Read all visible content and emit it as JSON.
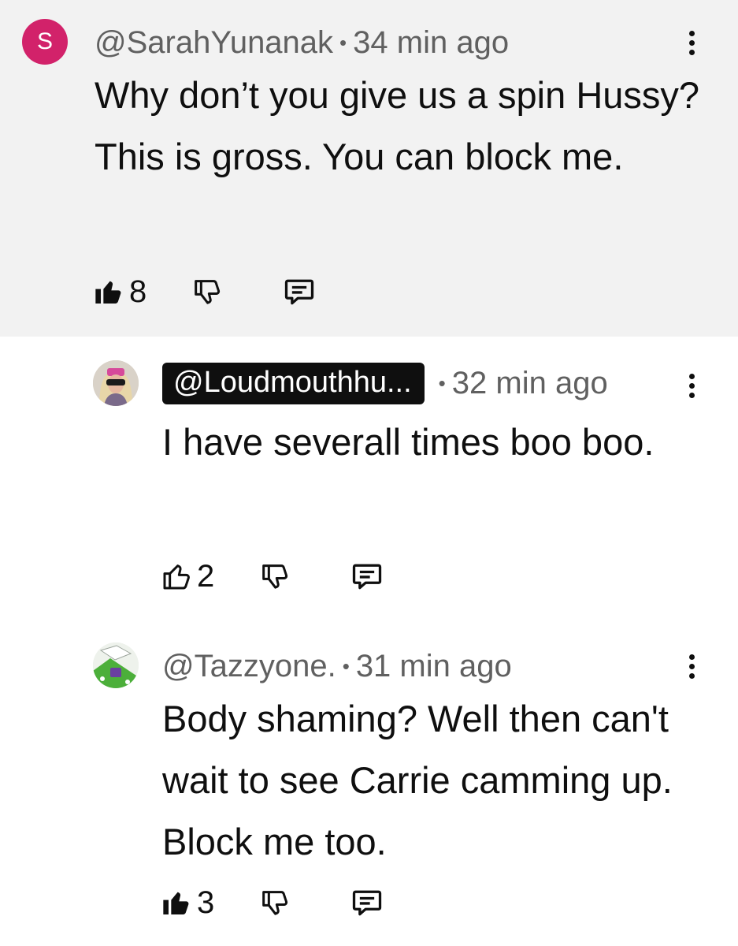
{
  "comments": [
    {
      "avatar_letter": "S",
      "handle": "@SarahYunanak",
      "time": "34 min ago",
      "text": "Why don’t you give us a spin Hussy? This is gross. You can block me.",
      "likes": "8",
      "liked": true
    },
    {
      "handle": "@Loudmouthhu...",
      "time": "32 min ago",
      "text": "I have severall times boo boo.",
      "likes": "2",
      "liked": false
    },
    {
      "handle": "@Tazzyone.",
      "time": "31 min ago",
      "text": "Body shaming? Well then can't wait to see Carrie camming up. Block me too.",
      "likes": "3",
      "liked": true
    }
  ],
  "separator": "•",
  "colors": {
    "highlight_bg": "#f2f2f2",
    "avatar_s": "#d2226a",
    "handle_chip_bg": "#0f0f0f",
    "secondary_text": "#606060"
  },
  "icons": {
    "like_filled": "thumbs-up-filled-icon",
    "like_outline": "thumbs-up-outline-icon",
    "dislike": "thumbs-down-icon",
    "reply": "reply-comment-icon",
    "menu": "more-vertical-icon"
  }
}
